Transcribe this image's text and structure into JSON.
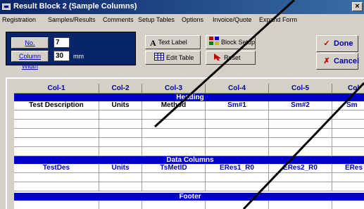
{
  "window": {
    "title": "Result Block 2 (Sample Columns)",
    "close_glyph": "×"
  },
  "menu": [
    "Registration",
    "Samples/Results",
    "Comments",
    "Setup Tables",
    "Options",
    "Invoice/Quote",
    "Expand Form"
  ],
  "column_settings": {
    "count_button": "No. Columns",
    "count_value": "7",
    "width_button": "Column Width",
    "width_value": "30",
    "width_unit": "mm"
  },
  "tools": {
    "text_label": "Text Label",
    "block_setup": "Block Setup",
    "edit_table": "Edit Table",
    "reset": "Reset"
  },
  "actions": {
    "done": "Done",
    "cancel": "Cancel"
  },
  "grid": {
    "columns": [
      "Col-1",
      "Col-2",
      "Col-3",
      "Col-4",
      "Col-5",
      "Col"
    ],
    "heading": {
      "title": "Heading",
      "cells": [
        "Test Description",
        "Units",
        "Method",
        "Sm#1",
        "Sm#2",
        "Sm"
      ]
    },
    "data": {
      "title": "Data Columns",
      "cells": [
        "TestDes",
        "Units",
        "TsMetID",
        "ERes1_R0",
        "ERes2_R0",
        "ERes"
      ]
    },
    "footer": {
      "title": "Footer"
    }
  },
  "colors": {
    "section_blue": "#0000c8",
    "panel_navy": "#08246a",
    "done_check": "#c00000",
    "cancel_x": "#c00000"
  }
}
